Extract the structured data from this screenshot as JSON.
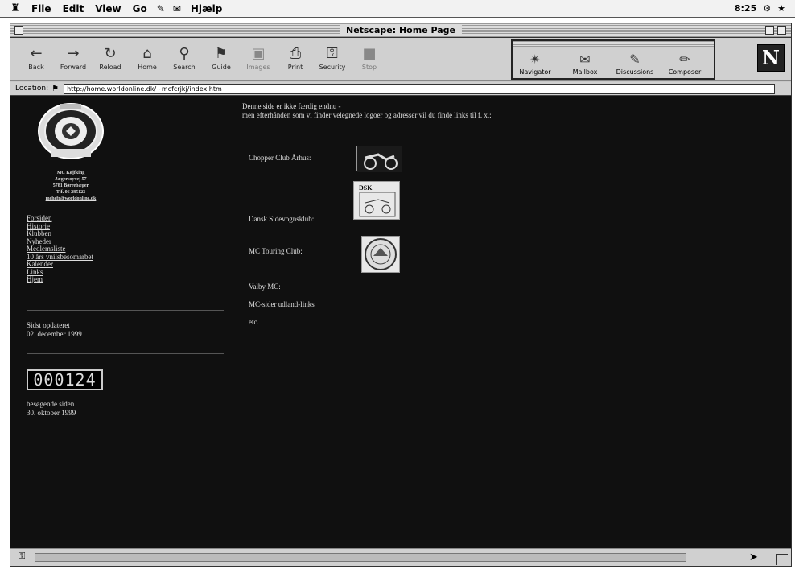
{
  "menubar": {
    "items": [
      "File",
      "Edit",
      "View",
      "Go",
      "Hjælp"
    ],
    "clock": "8:25"
  },
  "window": {
    "title": "Netscape: Home Page"
  },
  "toolbar": {
    "buttons": [
      "Back",
      "Forward",
      "Reload",
      "Home",
      "Search",
      "Guide",
      "Images",
      "Print",
      "Security",
      "Stop"
    ]
  },
  "components": {
    "buttons": [
      "Navigator",
      "Mailbox",
      "Discussions",
      "Composer"
    ],
    "logo": "N"
  },
  "location": {
    "label": "Location:",
    "url": "http://home.worldonline.dk/~mcfcrjkj/index.htm"
  },
  "page": {
    "address": [
      "MC Køjfking",
      "Jægersoyvej 57",
      "5781 Børrebæger",
      "Tlf. 06 285123",
      "mchefr@worldonline.dk"
    ],
    "nav": [
      "Forsiden",
      "Historie",
      "Klubben",
      "Nyheder",
      "Medlemsliste",
      "10 års vnilsbesomarbet",
      "Kalender",
      "Links",
      "Hjem"
    ],
    "updated": [
      "Sidst opdateret",
      "02. december 1999"
    ],
    "counter": "000124",
    "visits": [
      "besøgende siden",
      "30. oktober 1999"
    ],
    "intro": [
      "Denne side er ikke færdig endnu -",
      "men efterhånden som vi finder velegnede logoer og adresser vil du finde links til f. x.:"
    ],
    "links": [
      "Chopper Club Århus:",
      "Dansk Sidevognsklub:",
      "MC Touring Club:",
      "Valby MC:",
      "MC-sider udland-links",
      "etc."
    ],
    "dsk_badge": "DSK"
  }
}
